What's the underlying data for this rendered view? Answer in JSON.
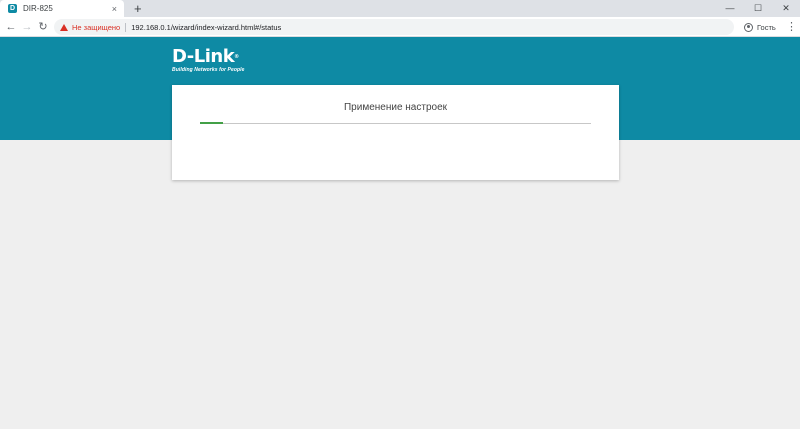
{
  "browser": {
    "tab_title": "DIR-825",
    "tab_close": "×",
    "new_tab": "+",
    "window_controls": {
      "minimize": "—",
      "maximize": "☐",
      "close": "✕"
    },
    "nav": {
      "back": "←",
      "forward": "→",
      "reload": "↻"
    },
    "not_secure_label": "Не защищено",
    "url": "192.168.0.1/wizard/index-wizard.html#/status",
    "profile_label": "Гость",
    "menu": "⋮"
  },
  "page": {
    "logo_text": "D-Link",
    "logo_registered": "®",
    "logo_tagline": "Building Networks for People",
    "card_title": "Применение настроек",
    "progress_fraction": 0.06,
    "colors": {
      "header": "#0e8aa4",
      "progress": "#43a047",
      "warning": "#d93025"
    }
  }
}
